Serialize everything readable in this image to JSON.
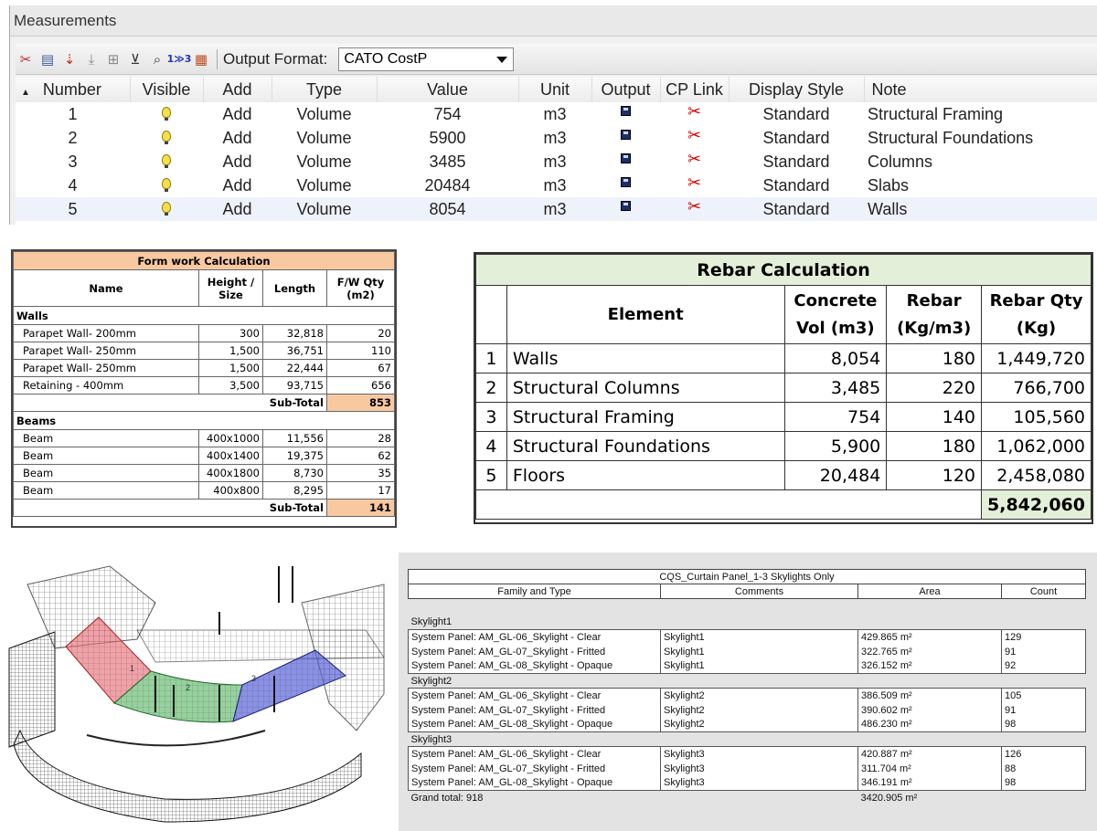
{
  "measurements": {
    "title": "Measurements",
    "toolbar": {
      "icons": [
        "delete-measure-icon",
        "edit-measure-icon",
        "export-measure-icon",
        "move-down-icon",
        "add-measure-icon",
        "filter-icon",
        "zoom-icon",
        "renumber-icon",
        "table-icon"
      ],
      "output_format_label": "Output Format:",
      "output_format_value": "CATO CostP"
    },
    "columns": [
      "Number",
      "Visible",
      "Add",
      "Type",
      "Value",
      "Unit",
      "Output",
      "CP Link",
      "Display Style",
      "Note"
    ],
    "rows": [
      {
        "number": "1",
        "add": "Add",
        "type": "Volume",
        "value": "754",
        "unit": "m3",
        "display": "Standard",
        "note": "Structural Framing"
      },
      {
        "number": "2",
        "add": "Add",
        "type": "Volume",
        "value": "5900",
        "unit": "m3",
        "display": "Standard",
        "note": "Structural Foundations"
      },
      {
        "number": "3",
        "add": "Add",
        "type": "Volume",
        "value": "3485",
        "unit": "m3",
        "display": "Standard",
        "note": "Columns"
      },
      {
        "number": "4",
        "add": "Add",
        "type": "Volume",
        "value": "20484",
        "unit": "m3",
        "display": "Standard",
        "note": "Slabs"
      },
      {
        "number": "5",
        "add": "Add",
        "type": "Volume",
        "value": "8054",
        "unit": "m3",
        "display": "Standard",
        "note": "Walls"
      }
    ]
  },
  "formwork": {
    "title": "Form work Calculation",
    "headers": {
      "name": "Name",
      "height": "Height / Size",
      "length": "Length",
      "qty": "F/W Qty (m2)"
    },
    "sections": [
      {
        "name": "Walls",
        "subtotal_label": "Sub-Total",
        "subtotal": "853",
        "rows": [
          {
            "name": "Parapet Wall- 200mm",
            "size": "300",
            "length": "32,818",
            "qty": "20"
          },
          {
            "name": "Parapet Wall- 250mm",
            "size": "1,500",
            "length": "36,751",
            "qty": "110"
          },
          {
            "name": "Parapet Wall- 250mm",
            "size": "1,500",
            "length": "22,444",
            "qty": "67"
          },
          {
            "name": "Retaining - 400mm",
            "size": "3,500",
            "length": "93,715",
            "qty": "656"
          }
        ]
      },
      {
        "name": "Beams",
        "subtotal_label": "Sub-Total",
        "subtotal": "141",
        "rows": [
          {
            "name": "Beam",
            "size": "400x1000",
            "length": "11,556",
            "qty": "28"
          },
          {
            "name": "Beam",
            "size": "400x1400",
            "length": "19,375",
            "qty": "62"
          },
          {
            "name": "Beam",
            "size": "400x1800",
            "length": "8,730",
            "qty": "35"
          },
          {
            "name": "Beam",
            "size": "400x800",
            "length": "8,295",
            "qty": "17"
          }
        ]
      }
    ]
  },
  "rebar": {
    "title": "Rebar Calculation",
    "headers": {
      "element": "Element",
      "concrete": "Concrete Vol (m3)",
      "rebar": "Rebar (Kg/m3)",
      "qty": "Rebar Qty (Kg)"
    },
    "rows": [
      {
        "idx": "1",
        "element": "Walls",
        "concrete": "8,054",
        "rebar": "180",
        "qty": "1,449,720"
      },
      {
        "idx": "2",
        "element": "Structural Columns",
        "concrete": "3,485",
        "rebar": "220",
        "qty": "766,700"
      },
      {
        "idx": "3",
        "element": "Structural Framing",
        "concrete": "754",
        "rebar": "140",
        "qty": "105,560"
      },
      {
        "idx": "4",
        "element": "Structural Foundations",
        "concrete": "5,900",
        "rebar": "180",
        "qty": "1,062,000"
      },
      {
        "idx": "5",
        "element": "Floors",
        "concrete": "20,484",
        "rebar": "120",
        "qty": "2,458,080"
      }
    ],
    "total": "5,842,060"
  },
  "model": {
    "zone_labels": [
      "1",
      "2",
      "3"
    ],
    "colors": {
      "zone1": "#e8707a",
      "zone2": "#5fb86a",
      "zone3": "#5a62d8"
    }
  },
  "schedule": {
    "title": "CQS_Curtain Panel_1-3 Skylights Only",
    "headers": [
      "Family and Type",
      "Comments",
      "Area",
      "Count"
    ],
    "groups": [
      {
        "name": "Skylight1",
        "rows": [
          {
            "type": "System Panel: AM_GL-06_Skylight - Clear",
            "comment": "Skylight1",
            "area": "429.865 m²",
            "count": "129"
          },
          {
            "type": "System Panel: AM_GL-07_Skylight - Fritted",
            "comment": "Skylight1",
            "area": "322.765 m²",
            "count": "91"
          },
          {
            "type": "System Panel: AM_GL-08_Skylight - Opaque",
            "comment": "Skylight1",
            "area": "326.152 m²",
            "count": "92"
          }
        ]
      },
      {
        "name": "Skylight2",
        "rows": [
          {
            "type": "System Panel: AM_GL-06_Skylight - Clear",
            "comment": "Skylight2",
            "area": "386.509 m²",
            "count": "105"
          },
          {
            "type": "System Panel: AM_GL-07_Skylight - Fritted",
            "comment": "Skylight2",
            "area": "390.602 m²",
            "count": "91"
          },
          {
            "type": "System Panel: AM_GL-08_Skylight - Opaque",
            "comment": "Skylight2",
            "area": "486.230 m²",
            "count": "98"
          }
        ]
      },
      {
        "name": "Skylight3",
        "rows": [
          {
            "type": "System Panel: AM_GL-06_Skylight - Clear",
            "comment": "Skylight3",
            "area": "420.887 m²",
            "count": "126"
          },
          {
            "type": "System Panel: AM_GL-07_Skylight - Fritted",
            "comment": "Skylight3",
            "area": "311.704 m²",
            "count": "88"
          },
          {
            "type": "System Panel: AM_GL-08_Skylight - Opaque",
            "comment": "Skylight3",
            "area": "346.191 m²",
            "count": "98"
          }
        ]
      }
    ],
    "grand_total_label": "Grand total: 918",
    "grand_total_area": "3420.905 m²"
  }
}
